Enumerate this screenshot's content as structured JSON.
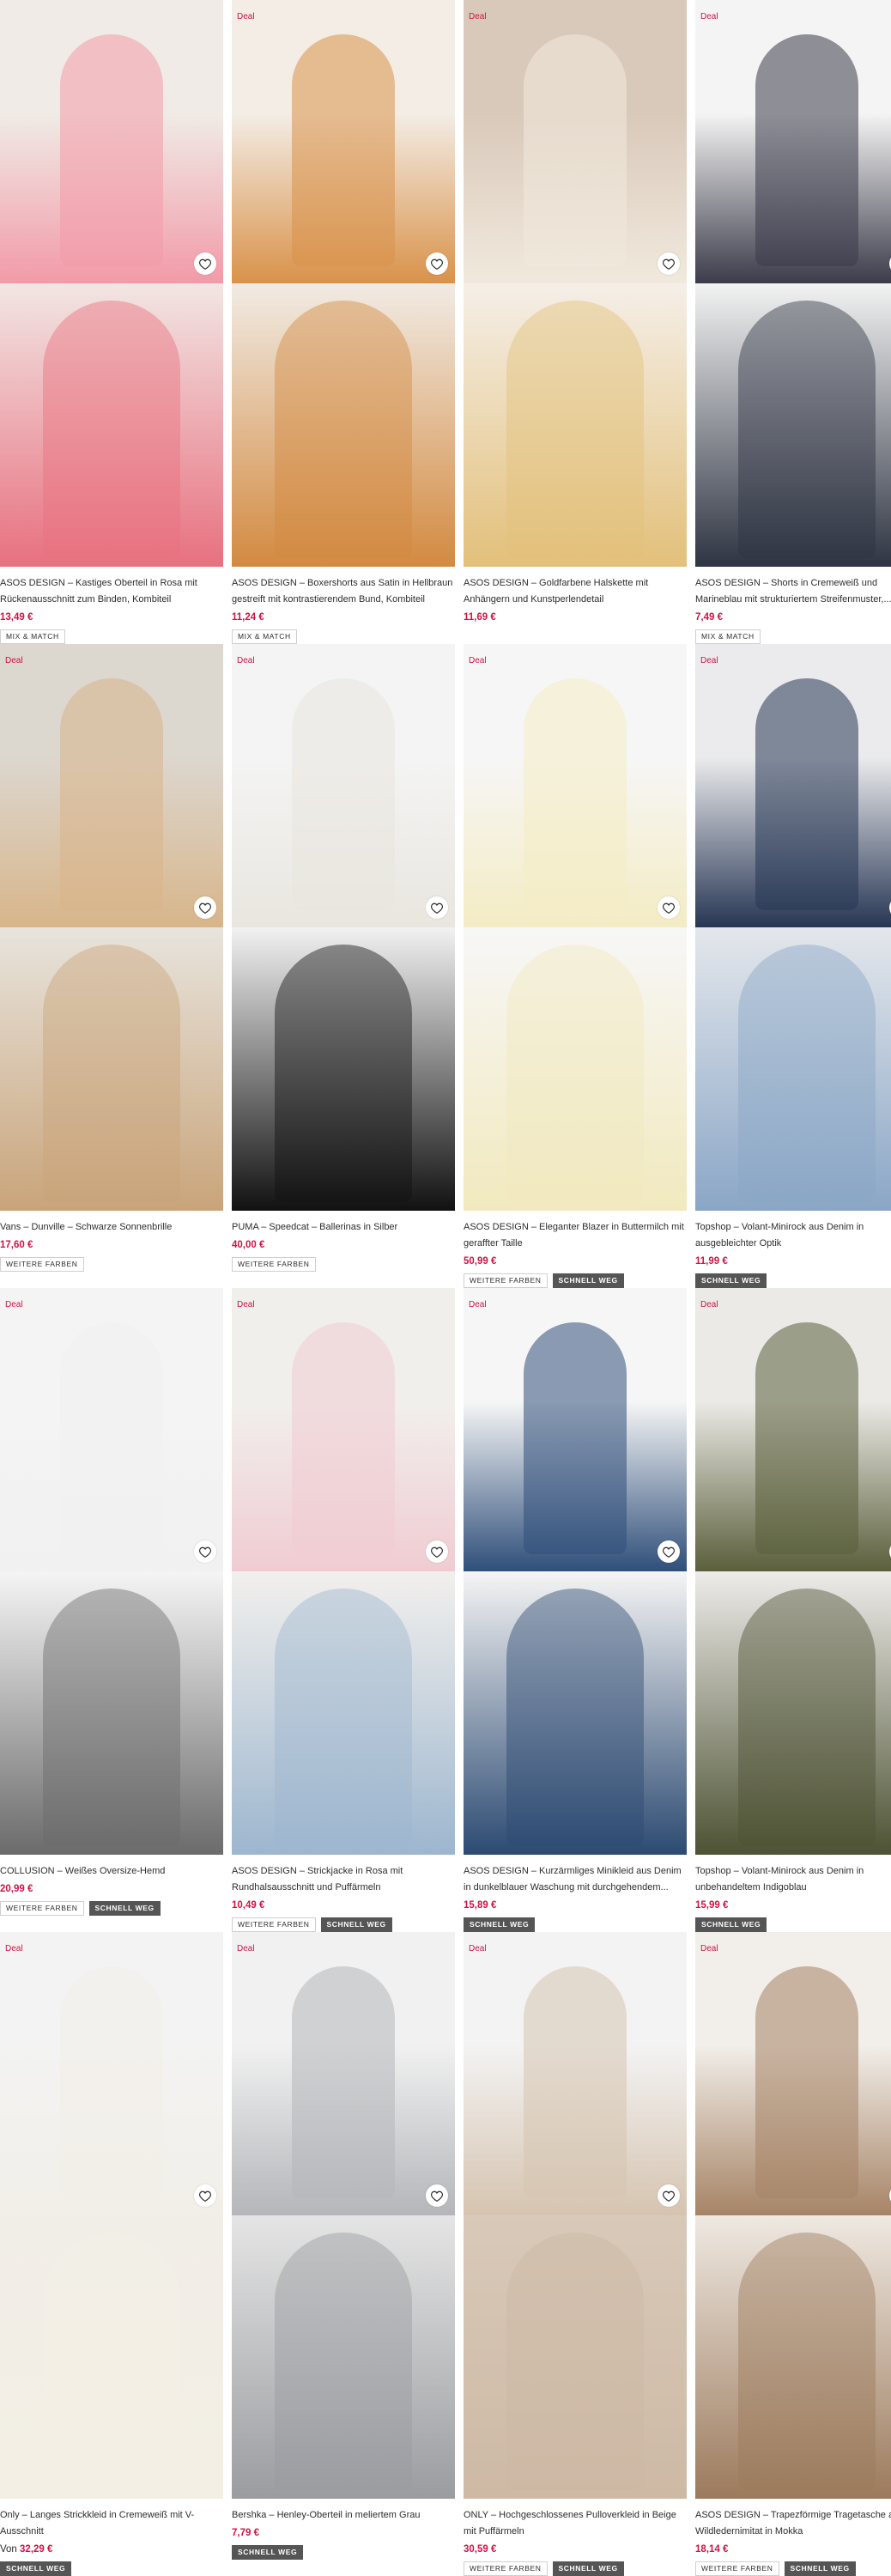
{
  "deal_label": "Deal",
  "products": [
    {
      "title": "ASOS DESIGN – Kastiges Oberteil in Rosa mit Rückenausschnitt zum Binden, Kombiteil",
      "price": "13,49 €",
      "badges": [
        "MIX & MATCH"
      ],
      "deal": false
    },
    {
      "title": "ASOS DESIGN – Boxershorts aus Satin in Hellbraun gestreift mit kontrastierendem Bund, Kombiteil",
      "price": "11,24 €",
      "badges": [
        "MIX & MATCH"
      ],
      "deal": true
    },
    {
      "title": "ASOS DESIGN – Goldfarbene Halskette mit Anhängern und Kunstperlendetail",
      "price": "11,69 €",
      "badges": [],
      "deal": true
    },
    {
      "title": "ASOS DESIGN – Shorts in Cremeweiß und Marineblau mit strukturiertem Streifenmuster,...",
      "price": "7,49 €",
      "badges": [
        "MIX & MATCH"
      ],
      "deal": true
    },
    {
      "title": "Vans – Dunville – Schwarze Sonnenbrille",
      "price": "17,60 €",
      "badges": [
        "WEITERE FARBEN"
      ],
      "deal": true
    },
    {
      "title": "PUMA – Speedcat – Ballerinas in Silber",
      "price": "40,00 €",
      "badges": [
        "WEITERE FARBEN"
      ],
      "deal": true
    },
    {
      "title": "ASOS DESIGN – Eleganter Blazer in Buttermilch mit geraffter Taille",
      "price": "50,99 €",
      "badges": [
        "WEITERE FARBEN",
        "SCHNELL WEG"
      ],
      "deal": true
    },
    {
      "title": "Topshop – Volant-Minirock aus Denim in ausgebleichter Optik",
      "price": "11,99 €",
      "badges": [
        "SCHNELL WEG"
      ],
      "deal": true
    },
    {
      "title": "COLLUSION – Weißes Oversize-Hemd",
      "price": "20,99 €",
      "badges": [
        "WEITERE FARBEN",
        "SCHNELL WEG"
      ],
      "deal": true
    },
    {
      "title": "ASOS DESIGN – Strickjacke in Rosa mit Rundhalsausschnitt und Puffärmeln",
      "price": "10,49 €",
      "badges": [
        "WEITERE FARBEN",
        "SCHNELL WEG"
      ],
      "deal": true
    },
    {
      "title": "ASOS DESIGN – Kurzärmliges Minikleid aus Denim in dunkelblauer Waschung mit durchgehendem...",
      "price": "15,89 €",
      "badges": [
        "SCHNELL WEG"
      ],
      "deal": true
    },
    {
      "title": "Topshop – Volant-Minirock aus Denim in unbehandeltem Indigoblau",
      "price": "15,99 €",
      "badges": [
        "SCHNELL WEG"
      ],
      "deal": true
    },
    {
      "title": "Only – Langes Strickkleid in Cremeweiß mit V-Ausschnitt",
      "price": "32,29 €",
      "price_prefix": "Von",
      "badges": [
        "SCHNELL WEG"
      ],
      "deal": true
    },
    {
      "title": "Bershka – Henley-Oberteil in meliertem Grau",
      "price": "7,79 €",
      "badges": [
        "SCHNELL WEG"
      ],
      "deal": true
    },
    {
      "title": "ONLY – Hochgeschlossenes Pulloverkleid in Beige mit Puffärmeln",
      "price": "30,59 €",
      "badges": [
        "WEITERE FARBEN",
        "SCHNELL WEG"
      ],
      "deal": true
    },
    {
      "title": "ASOS DESIGN – Trapezförmige Tragetasche aus Wildledernimitat in Mokka",
      "price": "18,14 €",
      "badges": [
        "WEITERE FARBEN",
        "SCHNELL WEG"
      ],
      "deal": true
    }
  ],
  "colors": {
    "price": "#d01345",
    "deal": "#d01345",
    "badge_dark": "#555555"
  },
  "icons": [
    "heart-icon"
  ]
}
